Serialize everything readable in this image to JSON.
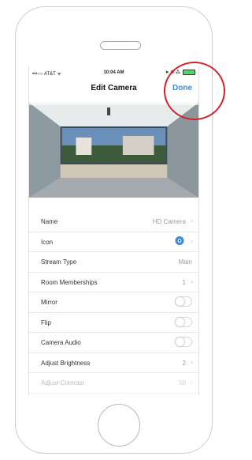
{
  "status_bar": {
    "carrier": "•••○○ AT&T ᯤ",
    "time": "10:04 AM",
    "indicators": "➤ ✱ ⁂"
  },
  "nav": {
    "title": "Edit Camera",
    "done_label": "Done"
  },
  "settings": [
    {
      "label": "Name",
      "value": "HD Camera",
      "control": "chevron"
    },
    {
      "label": "Icon",
      "value": "",
      "control": "icon"
    },
    {
      "label": "Stream Type",
      "value": "Main",
      "control": "value"
    },
    {
      "label": "Room Memberships",
      "value": "1",
      "control": "chevron"
    },
    {
      "label": "Mirror",
      "value": "",
      "control": "toggle",
      "on": false
    },
    {
      "label": "Flip",
      "value": "",
      "control": "toggle",
      "on": false
    },
    {
      "label": "Camera Audio",
      "value": "",
      "control": "toggle",
      "on": false
    },
    {
      "label": "Adjust Brightness",
      "value": "2",
      "control": "chevron"
    },
    {
      "label": "Adjust Contrast",
      "value": "50",
      "control": "chevron"
    }
  ],
  "icons": {
    "row_chevron": "chevron-right-icon",
    "camera_icon": "camera-icon",
    "annotation": "red-circle-highlight"
  },
  "colors": {
    "accent": "#2f8cf0",
    "annotation": "#d42127",
    "battery": "#4cd964"
  }
}
